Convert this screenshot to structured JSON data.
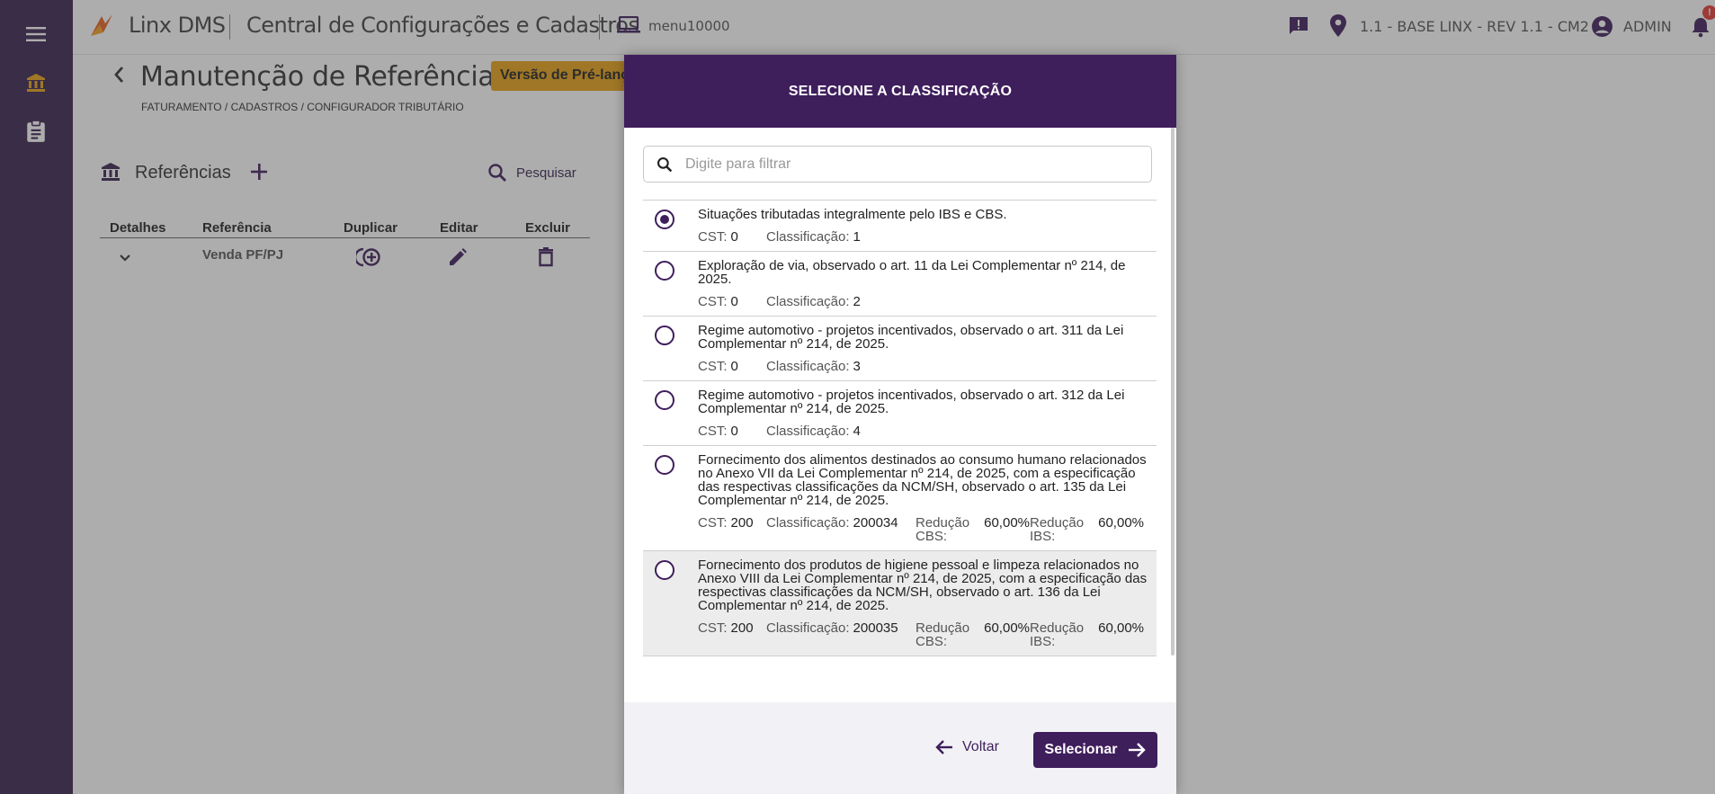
{
  "header": {
    "brand": "Linx DMS",
    "app_title": "Central de Configurações e Cadastros",
    "menu_code": "menu10000",
    "location": "1.1 - BASE LINX - REV 1.1 - CM2",
    "user": "ADMIN",
    "notification_count": "!"
  },
  "page": {
    "title": "Manutenção de Referências",
    "badge": "Versão de Pré-lançamento",
    "breadcrumb": "FATURAMENTO / CADASTROS / CONFIGURADOR TRIBUTÁRIO",
    "section_title": "Referências",
    "search_label": "Pesquisar",
    "table": {
      "headers": [
        "Detalhes",
        "Referência",
        "Duplicar",
        "Editar",
        "Excluir"
      ],
      "rows": [
        {
          "referencia": "Venda PF/PJ"
        }
      ]
    }
  },
  "modal": {
    "title": "SELECIONE A CLASSIFICAÇÃO",
    "filter_placeholder": "Digite para filtrar",
    "labels": {
      "cst": "CST:",
      "classificacao": "Classificação:",
      "reducao_cbs": "Redução CBS:",
      "reducao_ibs": "Redução IBS:"
    },
    "items": [
      {
        "selected": true,
        "description": "Situações tributadas integralmente pelo IBS e CBS.",
        "cst": "0",
        "classificacao": "1"
      },
      {
        "selected": false,
        "description": "Exploração de via, observado o art. 11 da Lei Complementar nº 214, de 2025.",
        "cst": "0",
        "classificacao": "2"
      },
      {
        "selected": false,
        "description": "Regime automotivo - projetos incentivados, observado o art. 311 da Lei Complementar nº 214, de 2025.",
        "cst": "0",
        "classificacao": "3"
      },
      {
        "selected": false,
        "description": "Regime automotivo - projetos incentivados, observado o art. 312 da Lei Complementar nº 214, de 2025.",
        "cst": "0",
        "classificacao": "4"
      },
      {
        "selected": false,
        "description": "Fornecimento dos alimentos destinados ao consumo humano relacionados no Anexo VII da Lei Complementar nº 214, de 2025, com a especificação das respectivas classificações da NCM/SH, observado o art. 135 da Lei Complementar nº 214, de 2025.",
        "cst": "200",
        "classificacao": "200034",
        "reducao_cbs": "60,00%",
        "reducao_ibs": "60,00%"
      },
      {
        "selected": false,
        "description": "Fornecimento dos produtos de higiene pessoal e limpeza relacionados no Anexo VIII da Lei Complementar nº 214, de 2025, com a especificação das respectivas classificações da NCM/SH, observado o art. 136 da Lei Complementar nº 214, de 2025.",
        "cst": "200",
        "classificacao": "200035",
        "reducao_cbs": "60,00%",
        "reducao_ibs": "60,00%"
      }
    ],
    "back_label": "Voltar",
    "select_label": "Selecionar"
  },
  "colors": {
    "primary": "#3f1e5c",
    "rail": "#3a2352",
    "accent": "#e8a317"
  }
}
